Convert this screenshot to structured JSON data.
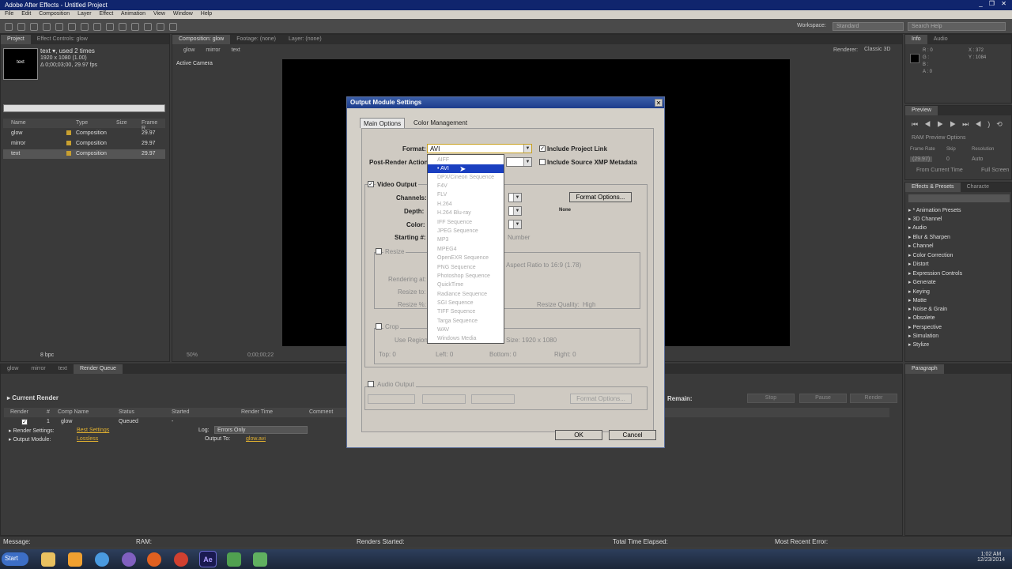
{
  "app": {
    "title": "Adobe After Effects - Untitled Project",
    "menu": "File  Edit  Composition  Layer  Effect  Animation  View  Window  Help",
    "workspace_label": "Workspace:",
    "workspace_value": "Standard",
    "search_placeholder": "Search Help"
  },
  "project_panel": {
    "tab_project": "Project",
    "tab_effect_controls": "Effect Controls: glow",
    "selected_name": "text ▾, used 2 times",
    "selected_size": "1920 x 1080 (1.00)",
    "selected_duration": "Δ 0;00;03;00, 29.97 fps",
    "columns": [
      "Name",
      "Type",
      "Size",
      "Frame R..."
    ],
    "items": [
      {
        "name": "glow",
        "type": "Composition",
        "fps": "29.97"
      },
      {
        "name": "mirror",
        "type": "Composition",
        "fps": "29.97"
      },
      {
        "name": "text",
        "type": "Composition",
        "fps": "29.97"
      }
    ],
    "bpc": "8 bpc"
  },
  "comp_panel": {
    "tabs": [
      "Composition: glow",
      "Footage: (none)",
      "Layer: (none)"
    ],
    "breadcrumbs": [
      "glow",
      "mirror",
      "text"
    ],
    "active_camera": "Active Camera",
    "renderer_label": "Renderer:",
    "renderer_value": "Classic 3D",
    "zoom": "50%",
    "timecode": "0;00;00;22"
  },
  "right_panels": {
    "info_tab": "Info",
    "audio_tab": "Audio",
    "info_values": [
      "R : 0",
      "G :",
      "B :",
      "A : 0"
    ],
    "info_xy": [
      "X : 372",
      "Y : 1084"
    ],
    "preview_tab": "Preview",
    "preview_options": "RAM Preview Options",
    "frame_rate_label": "Frame Rate",
    "skip_label": "Skip",
    "resolution_label": "Resolution",
    "frame_rate_value": "(29.97)",
    "skip_value": "0",
    "resolution_value": "Auto",
    "from_current": "From Current Time",
    "full_screen": "Full Screen",
    "effects_tab": "Effects & Presets",
    "character_tab": "Characte",
    "effects_list": [
      "* Animation Presets",
      "3D Channel",
      "Audio",
      "Blur & Sharpen",
      "Channel",
      "Color Correction",
      "Distort",
      "Expression Controls",
      "Generate",
      "Keying",
      "Matte",
      "Noise & Grain",
      "Obsolete",
      "Perspective",
      "Simulation",
      "Stylize"
    ],
    "paragraph_tab": "Paragraph"
  },
  "render_queue": {
    "tabs": [
      "glow",
      "mirror",
      "text",
      "Render Queue"
    ],
    "current_render": "Current Render",
    "remain_label": "Remain:",
    "stop": "Stop",
    "pause": "Pause",
    "render": "Render",
    "columns": [
      "Render",
      "#",
      "Comp Name",
      "Status",
      "Started",
      "Render Time",
      "Comment"
    ],
    "item_num": "1",
    "item_name": "glow",
    "item_status": "Queued",
    "item_started": "-",
    "render_settings_label": "Render Settings:",
    "render_settings_value": "Best Settings",
    "log_label": "Log:",
    "log_value": "Errors Only",
    "output_module_label": "Output Module:",
    "output_module_value": "Lossless",
    "output_to_label": "Output To:",
    "output_to_value": "glow.avi"
  },
  "dialog": {
    "title": "Output Module Settings",
    "tab_main": "Main Options",
    "tab_color": "Color Management",
    "format_label": "Format:",
    "format_value": "AVI",
    "include_project_link": "Include Project Link",
    "post_render_label": "Post-Render Action:",
    "include_xmp": "Include Source XMP Metadata",
    "video_output": "Video Output",
    "channels_label": "Channels:",
    "depth_label": "Depth:",
    "color_label": "Color:",
    "starting_label": "Starting #:",
    "number_text": "Number",
    "format_options": "Format Options...",
    "none_text": "None",
    "resize": "Resize",
    "aspect_text": "Aspect Ratio to 16:9 (1.78)",
    "rendering_at": "Rendering at:",
    "resize_to": "Resize to:",
    "resize_pct": "Resize %:",
    "resize_quality_label": "Resize Quality:",
    "resize_quality_value": "High",
    "crop": "Crop",
    "use_region": "Use Region of Interest",
    "final_size": "Size: 1920 x 1080",
    "top": "Top:",
    "top_v": "0",
    "left": "Left:",
    "left_v": "0",
    "bottom": "Bottom:",
    "bottom_v": "0",
    "right": "Right:",
    "right_v": "0",
    "audio_output": "Audio Output",
    "audio_format_options": "Format Options...",
    "ok": "OK",
    "cancel": "Cancel"
  },
  "format_dropdown": [
    "AIFF",
    "AVI",
    "DPX/Cineon Sequence",
    "F4V",
    "FLV",
    "H.264",
    "H.264 Blu-ray",
    "IFF Sequence",
    "JPEG Sequence",
    "MP3",
    "MPEG4",
    "OpenEXR Sequence",
    "PNG Sequence",
    "Photoshop Sequence",
    "QuickTime",
    "Radiance Sequence",
    "SGI Sequence",
    "TIFF Sequence",
    "Targa Sequence",
    "WAV",
    "Windows Media"
  ],
  "status_bar": {
    "message": "Message:",
    "ram": "RAM:",
    "renders_started": "Renders Started:",
    "total_time": "Total Time Elapsed:",
    "recent_error": "Most Recent Error:"
  },
  "taskbar": {
    "start": "Start",
    "time": "1:02 AM",
    "date": "12/23/2014"
  }
}
